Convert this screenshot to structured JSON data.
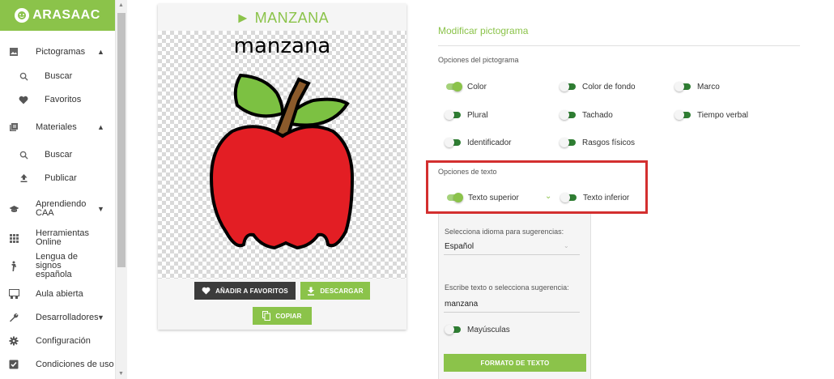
{
  "sidebar": {
    "logo": "ARASAAC",
    "items": [
      {
        "label": "Pictogramas",
        "icon": "image-icon",
        "chevron": "^"
      },
      {
        "label": "Buscar",
        "icon": "search-icon"
      },
      {
        "label": "Favoritos",
        "icon": "heart-icon"
      },
      {
        "label": "Materiales",
        "icon": "library-icon",
        "chevron": "^"
      },
      {
        "label": "Buscar",
        "icon": "search-icon"
      },
      {
        "label": "Publicar",
        "icon": "upload-icon"
      },
      {
        "label": "Aprendiendo CAA",
        "icon": "school-icon",
        "chevron": "v"
      },
      {
        "label": "Herramientas Online",
        "icon": "apps-icon"
      },
      {
        "label": "Lengua de signos española",
        "icon": "sign-language-icon"
      },
      {
        "label": "Aula abierta",
        "icon": "classroom-icon"
      },
      {
        "label": "Desarrolladores",
        "icon": "wrench-icon",
        "chevron": "v"
      },
      {
        "label": "Configuración",
        "icon": "gear-icon"
      },
      {
        "label": "Condiciones de uso",
        "icon": "checkbox-icon"
      }
    ]
  },
  "card": {
    "title": "► MANZANA",
    "word": "manzana",
    "favorite_label": "AÑADIR A FAVORITOS",
    "download_label": "DESCARGAR",
    "copy_label": "COPIAR"
  },
  "panel": {
    "title": "Modificar pictograma",
    "picto_options_label": "Opciones del pictograma",
    "picto_options": [
      {
        "label": "Color",
        "on": true
      },
      {
        "label": "Color de fondo",
        "on": false
      },
      {
        "label": "Marco",
        "on": false
      },
      {
        "label": "Plural",
        "on": false
      },
      {
        "label": "Tachado",
        "on": false
      },
      {
        "label": "Tiempo verbal",
        "on": false
      },
      {
        "label": "Identificador",
        "on": false
      },
      {
        "label": "Rasgos físicos",
        "on": false
      }
    ],
    "text_options_label": "Opciones de texto",
    "text_options": [
      {
        "label": "Texto superior",
        "on": true
      },
      {
        "label": "Texto inferior",
        "on": false
      }
    ],
    "language_label": "Selecciona idioma para sugerencias:",
    "language_value": "Español",
    "text_label": "Escribe texto o selecciona sugerencia:",
    "text_value": "manzana",
    "uppercase_label": "Mayúsculas",
    "format_button": "FORMATO DE TEXTO"
  },
  "colors": {
    "accent": "#8bc34a",
    "dark_button": "#3c3c3c",
    "highlight": "#d32f2f",
    "apple": "#e31e24",
    "leaf": "#7cc142",
    "stem": "#8b5a2b"
  }
}
